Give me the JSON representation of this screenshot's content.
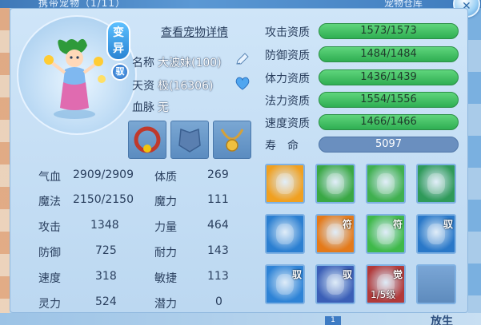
{
  "header": {
    "left_title": "携带宠物（1/11）",
    "right_title": "宠物仓库"
  },
  "pet": {
    "badge_variant": "变异",
    "badge_yu": "驭",
    "detail_link": "查看宠物详情",
    "name_label": "名称",
    "name_value": "大波妹(100)",
    "talent_label": "天资",
    "talent_value": "极(16306)",
    "bloodline_label": "血脉",
    "bloodline_value": "无"
  },
  "equipment": [
    {
      "name": "collar"
    },
    {
      "name": "armor"
    },
    {
      "name": "amulet"
    }
  ],
  "stats_left": [
    {
      "label": "气血",
      "value": "2909/2909"
    },
    {
      "label": "魔法",
      "value": "2150/2150"
    },
    {
      "label": "攻击",
      "value": "1348"
    },
    {
      "label": "防御",
      "value": "725"
    },
    {
      "label": "速度",
      "value": "318"
    },
    {
      "label": "灵力",
      "value": "524"
    }
  ],
  "stats_right": [
    {
      "label": "体质",
      "value": "269"
    },
    {
      "label": "魔力",
      "value": "111"
    },
    {
      "label": "力量",
      "value": "464"
    },
    {
      "label": "耐力",
      "value": "143"
    },
    {
      "label": "敏捷",
      "value": "113"
    },
    {
      "label": "潜力",
      "value": "0"
    }
  ],
  "aptitudes": [
    {
      "label": "攻击资质",
      "value": "1573/1573"
    },
    {
      "label": "防御资质",
      "value": "1484/1484"
    },
    {
      "label": "体力资质",
      "value": "1436/1439"
    },
    {
      "label": "法力资质",
      "value": "1554/1556"
    },
    {
      "label": "速度资质",
      "value": "1466/1466"
    }
  ],
  "life": {
    "label": "寿　命",
    "value": "5097"
  },
  "skills": [
    {
      "icon": "sword-skill-icon",
      "tag": "",
      "color": "#f0a020"
    },
    {
      "icon": "strength-skill-icon",
      "tag": "",
      "color": "#3aa845"
    },
    {
      "icon": "rush-skill-icon",
      "tag": "",
      "color": "#40b050"
    },
    {
      "icon": "shadow-skill-icon",
      "tag": "",
      "color": "#2f9a5a"
    },
    {
      "icon": "ice-skill-icon",
      "tag": "",
      "color": "#2b7fd1"
    },
    {
      "icon": "fire-rune-skill-icon",
      "tag": "符",
      "color": "#e47a1a"
    },
    {
      "icon": "heart-rune-skill-icon",
      "tag": "符",
      "color": "#3fb94a"
    },
    {
      "icon": "water-ride-skill-icon",
      "tag": "驭",
      "color": "#2a78c8"
    },
    {
      "icon": "shield-ride-skill-icon",
      "tag": "驭",
      "color": "#2e83d6"
    },
    {
      "icon": "wing-ride-skill-icon",
      "tag": "驭",
      "color": "#3b5fb7"
    },
    {
      "icon": "awaken-skill-icon",
      "tag": "觉",
      "color": "#b23a3a",
      "level": "1/5级"
    },
    {
      "icon": "empty-slot",
      "tag": "",
      "color": "#6f97c4"
    }
  ],
  "bottom": {
    "badge": "1",
    "right_text": "放生"
  }
}
